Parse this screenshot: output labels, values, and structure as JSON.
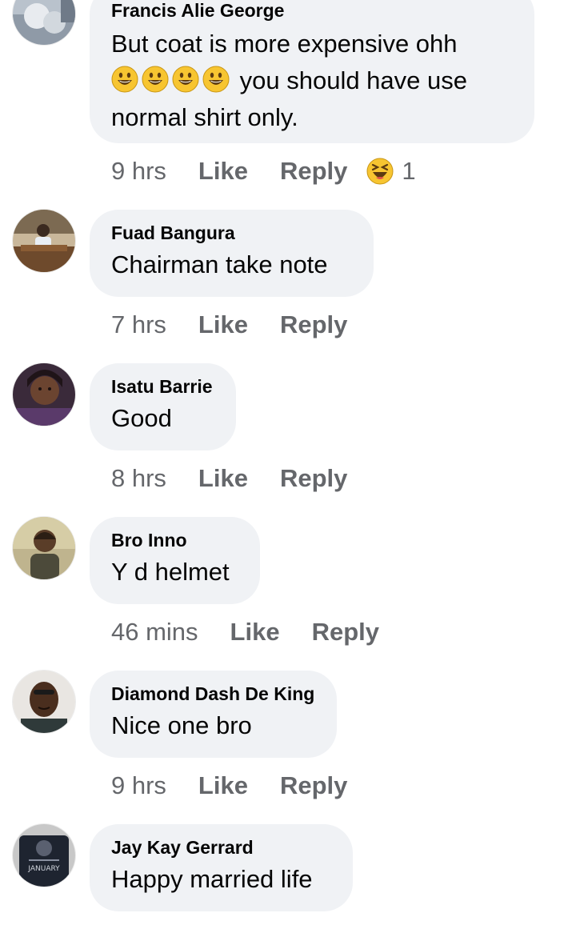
{
  "comments": [
    {
      "author": "Francis Alie George",
      "text_line1": "But coat is more expensive ohh",
      "text_line2": "you should have use",
      "text_line3": "normal shirt only.",
      "time": "9 hrs",
      "like": "Like",
      "reply": "Reply",
      "reaction_icon": "laughing-squint-emoji",
      "reaction_count": "1"
    },
    {
      "author": "Fuad Bangura",
      "text": "Chairman take note",
      "time": "7 hrs",
      "like": "Like",
      "reply": "Reply"
    },
    {
      "author": "Isatu Barrie",
      "text": "Good",
      "time": "8 hrs",
      "like": "Like",
      "reply": "Reply"
    },
    {
      "author": "Bro Inno",
      "text": "Y d helmet",
      "time": "46 mins",
      "like": "Like",
      "reply": "Reply"
    },
    {
      "author": "Diamond Dash De King",
      "text": "Nice one bro",
      "time": "9 hrs",
      "like": "Like",
      "reply": "Reply"
    },
    {
      "author": "Jay Kay Gerrard",
      "text": "Happy married life",
      "avatar_shirt_text": "JANUARY"
    }
  ],
  "colors": {
    "bubble": "#f0f2f5",
    "meta_text": "#65676b",
    "body_text": "#050505",
    "emoji_yellow": "#f7c531"
  }
}
